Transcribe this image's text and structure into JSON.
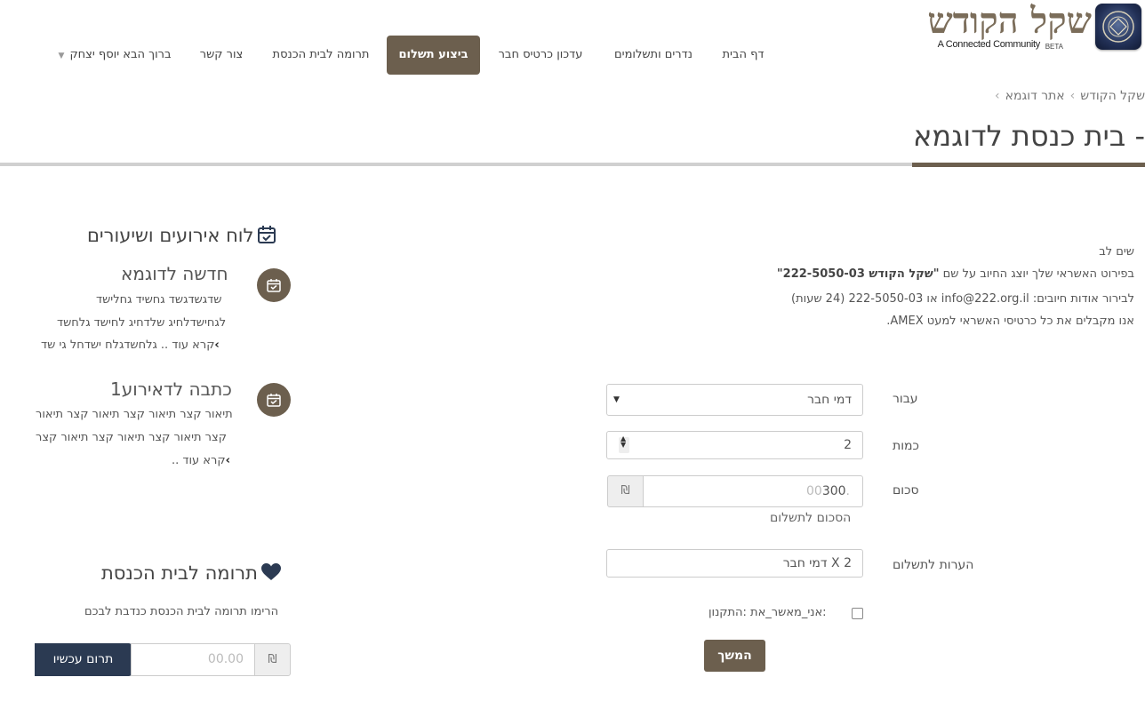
{
  "header": {
    "logo": {
      "main": "שקל הקודש",
      "sub": "A Connected Community",
      "beta": "BETA"
    },
    "nav": [
      {
        "label": "דף הבית",
        "active": false
      },
      {
        "label": "נדרים ותשלומים",
        "active": false
      },
      {
        "label": "עדכון כרטיס חבר",
        "active": false
      },
      {
        "label": "ביצוע תשלום",
        "active": true
      },
      {
        "label": "תרומה לבית הכנסת",
        "active": false
      },
      {
        "label": "צור קשר",
        "active": false
      },
      {
        "label": "ברוך הבא יוסף יצחק",
        "active": false,
        "dropdown": true
      }
    ]
  },
  "breadcrumb": {
    "items": [
      "שקל הקודש",
      "אתר דוגמא"
    ]
  },
  "page": {
    "title": "- בית כנסת לדוגמא"
  },
  "notice": {
    "heading": "שים לב",
    "line1_prefix": "בפירוט האשראי שלך יוצג החיוב על שם ",
    "line1_bold": "\"שקל הקודש 222-5050-03\"",
    "line2": "לבירור אודות חיובים: info@222.org.il או 222-5050-03 (24 שעות)",
    "line3": "אנו מקבלים את כל כרטיסי האשראי למעט AMEX."
  },
  "form": {
    "for_label": "עבור",
    "for_value": "דמי חבר",
    "qty_label": "כמות",
    "qty_value": "2",
    "sum_label": "סכום",
    "sum_value": "300",
    "sum_decimals": ".00",
    "currency": "₪",
    "sum_help": "הסכום לתשלום",
    "notes_label": "הערות לתשלום",
    "notes_value": "2 X דמי חבר",
    "agree_label": ":אני_מאשר_את :התקנון",
    "submit": "המשך"
  },
  "events": {
    "title": "לוח אירועים ושיעורים",
    "items": [
      {
        "title": "חדשה לדוגמא",
        "lines": [
          "שדגשדגשד גחשיד גחלישד",
          "לגחישדלחיג שלדחיג לחישד גלחשד",
          "גלחשדגלח ישדחל גי שד"
        ],
        "more": "קרא עוד .."
      },
      {
        "title": "כתבה לדאירוע1",
        "lines": [
          "תיאור קצר תיאור קצר תיאור קצר תיאור",
          "קצר תיאור קצר תיאור קצר תיאור קצר"
        ],
        "more": "קרא עוד .."
      }
    ]
  },
  "donation": {
    "title": "תרומה לבית הכנסת",
    "text": "הרימו תרומה לבית הכנסת כנדבת לבכם",
    "placeholder": "00.00",
    "currency": "₪",
    "button": "תרום עכשיו"
  },
  "colors": {
    "brand": "#6c5f4e",
    "navy": "#2b3a52",
    "heart": "#2b3a52"
  }
}
